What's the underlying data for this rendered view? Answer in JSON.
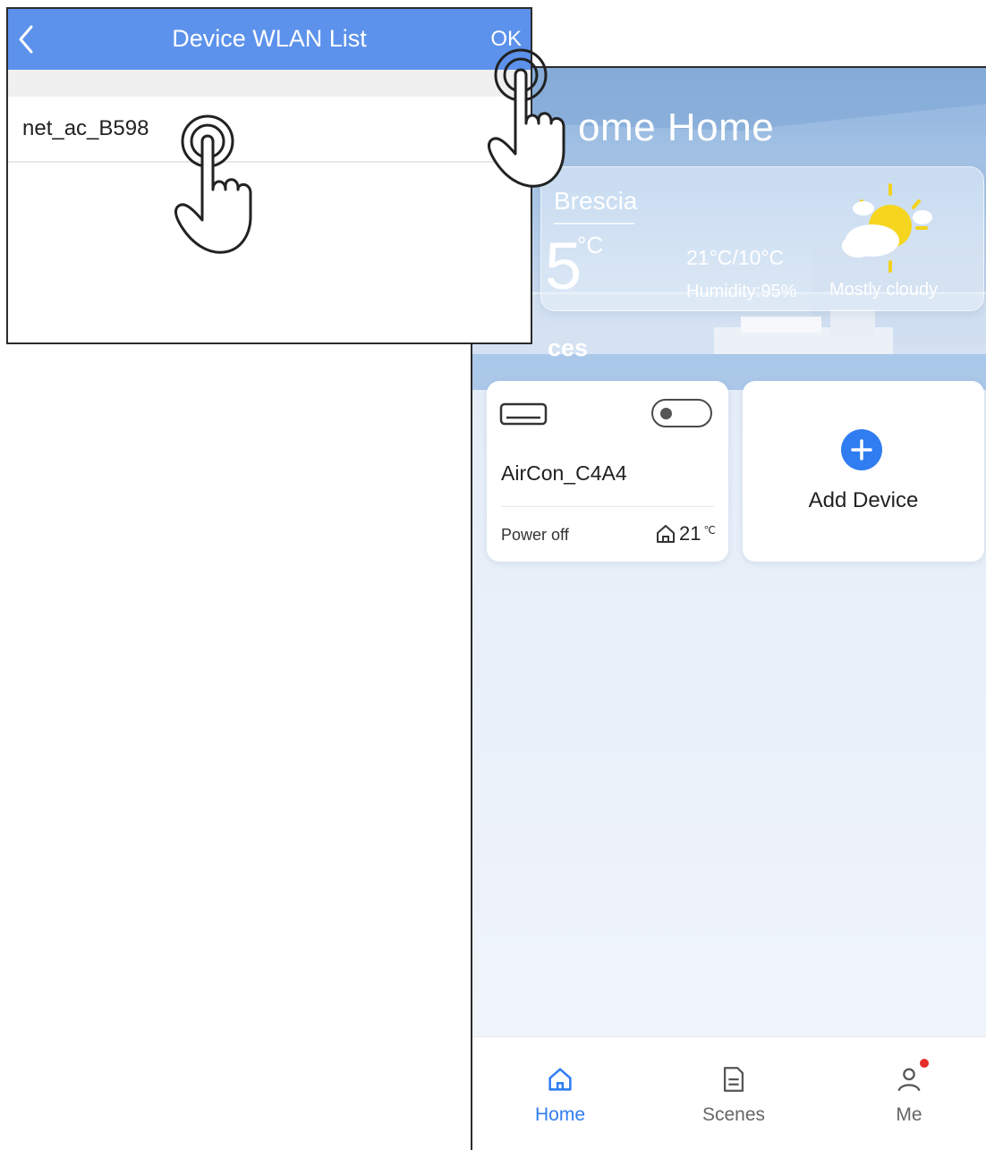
{
  "wlan_list": {
    "title": "Device WLAN List",
    "ok_label": "OK",
    "networks": [
      {
        "ssid": "net_ac_B598"
      }
    ]
  },
  "home": {
    "title": "ome Home",
    "weather": {
      "city": "Brescia",
      "current_temp": "5",
      "unit": "°C",
      "range": "21°C/10°C",
      "humidity": "Humidity:95%",
      "condition": "Mostly cloudy"
    },
    "devices_heading": "ces",
    "device": {
      "name": "AirCon_C4A4",
      "status": "Power off",
      "room_temp": "21",
      "room_temp_unit": "℃"
    },
    "add_device_label": "Add Device"
  },
  "tabbar": {
    "items": [
      {
        "label": "Home",
        "icon": "home-icon"
      },
      {
        "label": "Scenes",
        "icon": "scenes-icon"
      },
      {
        "label": "Me",
        "icon": "me-icon"
      }
    ]
  },
  "colors": {
    "accent": "#2f7df0",
    "header": "#5c92ec",
    "notification": "#e52b2b"
  }
}
